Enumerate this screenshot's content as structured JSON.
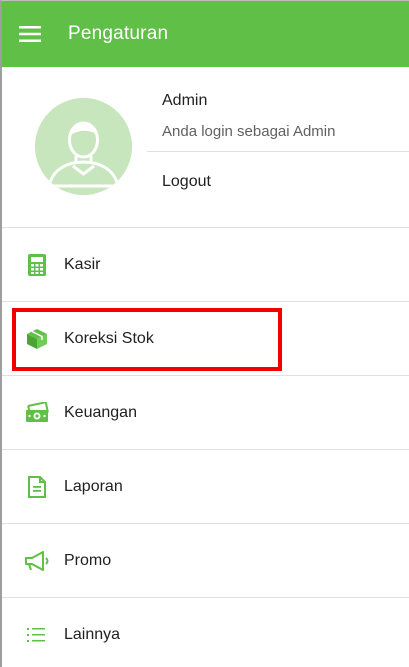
{
  "appbar": {
    "title": "Pengaturan",
    "menu_icon": "hamburger-menu-icon",
    "color": "#5fbf46"
  },
  "profile": {
    "name": "Admin",
    "role_text": "Anda login sebagai Admin",
    "logout_label": "Logout",
    "avatar_icon": "user-avatar-icon",
    "avatar_bg": "#c8e6bd"
  },
  "menu": {
    "items": [
      {
        "label": "Kasir",
        "icon": "calculator-icon"
      },
      {
        "label": "Koreksi Stok",
        "icon": "box-icon",
        "highlighted": true
      },
      {
        "label": "Keuangan",
        "icon": "money-icon"
      },
      {
        "label": "Laporan",
        "icon": "document-icon"
      },
      {
        "label": "Promo",
        "icon": "megaphone-icon"
      },
      {
        "label": "Lainnya",
        "icon": "list-icon"
      }
    ]
  },
  "colors": {
    "accent": "#5fbf46",
    "highlight": "#f20000"
  }
}
